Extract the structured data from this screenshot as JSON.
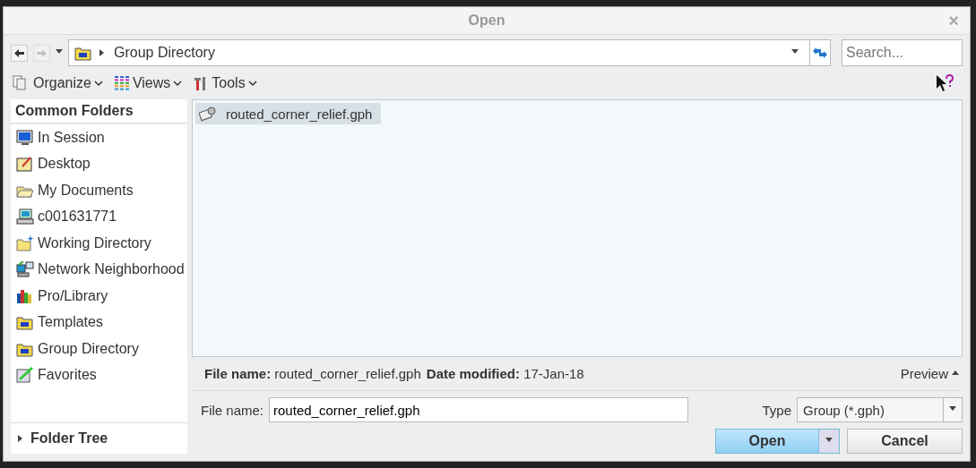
{
  "window": {
    "title": "Open",
    "close": "×"
  },
  "nav": {
    "path": "Group Directory",
    "search_placeholder": "Search..."
  },
  "toolbar": [
    {
      "label": "Organize",
      "kind": "organize"
    },
    {
      "label": "Views",
      "kind": "views"
    },
    {
      "label": "Tools",
      "kind": "tools"
    }
  ],
  "sidebar": {
    "title": "Common Folders",
    "items": [
      {
        "label": "In Session",
        "kind": "monitor",
        "selected": false
      },
      {
        "label": "Desktop",
        "kind": "desktop",
        "selected": false
      },
      {
        "label": "My Documents",
        "kind": "documents",
        "selected": false
      },
      {
        "label": "c001631771",
        "kind": "computer",
        "selected": false
      },
      {
        "label": "Working Directory",
        "kind": "workdir",
        "selected": false
      },
      {
        "label": "Network Neighborhood",
        "kind": "network",
        "selected": false
      },
      {
        "label": "Pro/Library",
        "kind": "library",
        "selected": false
      },
      {
        "label": "Templates",
        "kind": "folder",
        "selected": false
      },
      {
        "label": "Group Directory",
        "kind": "folder",
        "selected": false
      },
      {
        "label": "Favorites",
        "kind": "favorites",
        "selected": false
      }
    ],
    "folder_tree": "Folder Tree",
    "folder_tree_expanded": false
  },
  "files": [
    {
      "name": "routed_corner_relief.gph",
      "selected": true
    }
  ],
  "info": {
    "name_label": "File name:",
    "name": "routed_corner_relief.gph",
    "date_label": "Date modified:",
    "date": "17-Jan-18",
    "preview": "Preview"
  },
  "form": {
    "name_label": "File name:",
    "name_value": "routed_corner_relief.gph",
    "type_label": "Type",
    "type_value": "Group (*.gph)"
  },
  "buttons": {
    "open": "Open",
    "cancel": "Cancel"
  }
}
